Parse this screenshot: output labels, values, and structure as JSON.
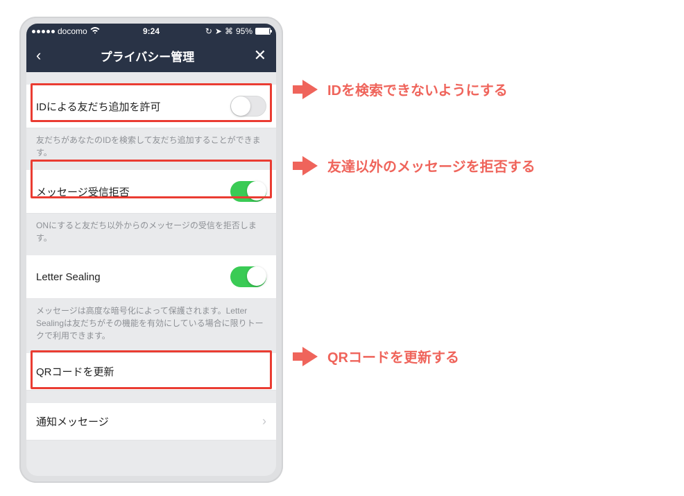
{
  "statusbar": {
    "carrier": "docomo",
    "time": "9:24",
    "battery_pct": "95%"
  },
  "navbar": {
    "title": "プライバシー管理"
  },
  "settings": {
    "allow_id": {
      "label": "IDによる友だち追加を許可",
      "desc": "友だちがあなたのIDを検索して友だち追加することができます。",
      "on": false
    },
    "block_msg": {
      "label": "メッセージ受信拒否",
      "desc": "ONにすると友だち以外からのメッセージの受信を拒否します。",
      "on": true
    },
    "letter_sealing": {
      "label": "Letter Sealing",
      "desc": "メッセージは高度な暗号化によって保護されます。Letter Sealingは友だちがその機能を有効にしている場合に限りトークで利用できます。",
      "on": true
    },
    "qr_update": {
      "label": "QRコードを更新"
    },
    "notif_msg": {
      "label": "通知メッセージ"
    }
  },
  "annotations": {
    "a1": "IDを検索できないようにする",
    "a2": "友達以外のメッセージを拒否する",
    "a3": "QRコードを更新する"
  }
}
